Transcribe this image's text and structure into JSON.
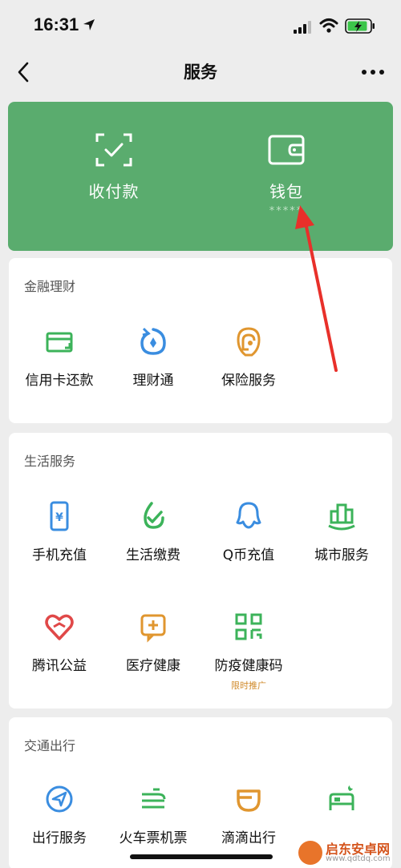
{
  "status_bar": {
    "time": "16:31"
  },
  "nav": {
    "title": "服务"
  },
  "green_card": {
    "pay_label": "收付款",
    "wallet_label": "钱包",
    "wallet_hidden_balance": "*****",
    "color": "#5aac6e"
  },
  "sections": {
    "finance": {
      "title": "金融理财",
      "items": [
        {
          "label": "信用卡还款",
          "icon": "credit-card-icon"
        },
        {
          "label": "理财通",
          "icon": "wealth-icon"
        },
        {
          "label": "保险服务",
          "icon": "insurance-icon"
        }
      ]
    },
    "life": {
      "title": "生活服务",
      "items": [
        {
          "label": "手机充值",
          "icon": "phone-topup-icon"
        },
        {
          "label": "生活缴费",
          "icon": "utility-icon"
        },
        {
          "label": "Q币充值",
          "icon": "qq-coin-icon"
        },
        {
          "label": "城市服务",
          "icon": "city-icon"
        },
        {
          "label": "腾讯公益",
          "icon": "charity-icon"
        },
        {
          "label": "医疗健康",
          "icon": "medical-icon"
        },
        {
          "label": "防疫健康码",
          "icon": "health-code-icon",
          "badge": "限时推广"
        }
      ]
    },
    "transport": {
      "title": "交通出行",
      "items": [
        {
          "label": "出行服务",
          "icon": "travel-icon"
        },
        {
          "label": "火车票机票",
          "icon": "train-ticket-icon"
        },
        {
          "label": "滴滴出行",
          "icon": "didi-icon"
        },
        {
          "label": "",
          "icon": "hotel-icon"
        }
      ]
    }
  },
  "watermark": {
    "name": "启东安卓网",
    "url": "www.qdtdq.com"
  },
  "colors": {
    "accent_green": "#3cb35a",
    "blue": "#3a8de0",
    "orange": "#e0962f",
    "red": "#e04848",
    "annotation": "#e8302a"
  }
}
